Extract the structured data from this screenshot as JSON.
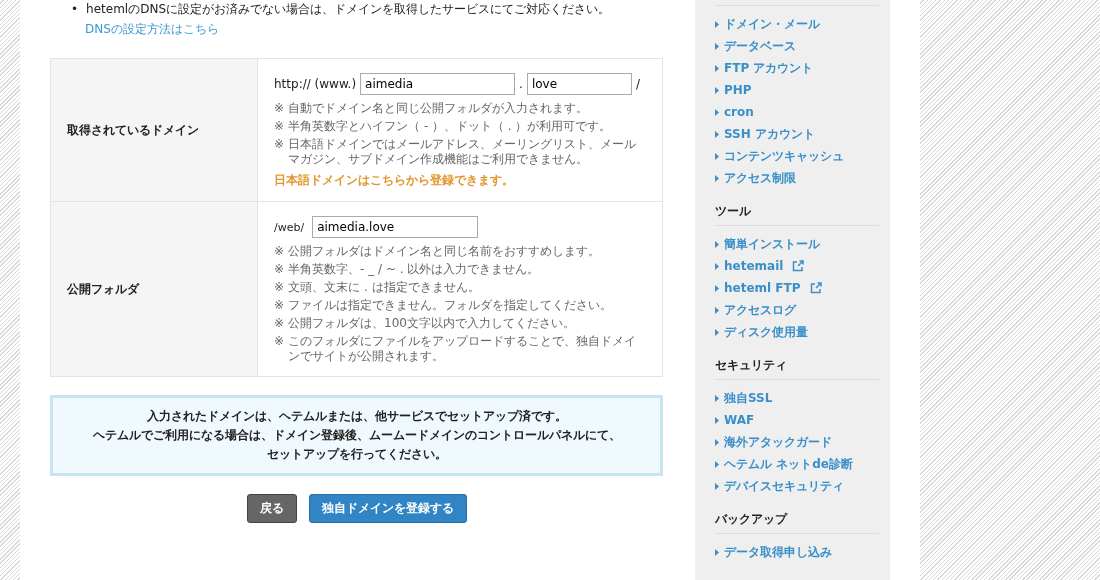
{
  "intro": {
    "bullet_mark": "•",
    "bullet": "hetemlのDNSに設定がお済みでない場合は、ドメインを取得したサービスにてご対応ください。",
    "link": "DNSの設定方法はこちら"
  },
  "form": {
    "rows": [
      {
        "kind": "domain",
        "label": "取得されているドメイン",
        "prefix": "http:// (www.)",
        "name_value": "aimedia",
        "dot": ".",
        "tld_value": "love",
        "suffix": "/",
        "notes": [
          "自動でドメイン名と同じ公開フォルダが入力されます。",
          "半角英数字とハイフン（ - ）、ドット（ . ）が利用可です。",
          "日本語ドメインではメールアドレス、メーリングリスト、メールマガジン、サブドメイン作成機能はご利用できません。"
        ],
        "note_mark": "※",
        "link": "日本語ドメインはこちらから登録できます。"
      },
      {
        "kind": "folder",
        "label": "公開フォルダ",
        "prefix": "/web/",
        "value": "aimedia.love",
        "notes": [
          "公開フォルダはドメイン名と同じ名前をおすすめします。",
          "半角英数字、- _ / ~ . 以外は入力できません。",
          "文頭、文末に . は指定できません。",
          "ファイルは指定できません。フォルダを指定してください。",
          "公開フォルダは、100文字以内で入力してください。",
          "このフォルダにファイルをアップロードすることで、独自ドメインでサイトが公開されます。"
        ],
        "note_mark": "※"
      }
    ]
  },
  "notice": [
    "入力されたドメインは、ヘテムルまたは、他サービスでセットアップ済です。",
    "ヘテムルでご利用になる場合は、ドメイン登録後、ムームードメインのコントロールパネルにて、",
    "セットアップを行ってください。"
  ],
  "buttons": [
    {
      "kind": "back",
      "label": "戻る"
    },
    {
      "kind": "primary",
      "label": "独自ドメインを登録する"
    }
  ],
  "sidebar": {
    "sections": [
      {
        "items": [
          {
            "label": "ドメイン・メール",
            "external": false
          },
          {
            "label": "データベース",
            "external": false
          },
          {
            "label": "FTP アカウント",
            "external": false
          },
          {
            "label": "PHP",
            "external": false
          },
          {
            "label": "cron",
            "external": false
          },
          {
            "label": "SSH アカウント",
            "external": false
          },
          {
            "label": "コンテンツキャッシュ",
            "external": false
          },
          {
            "label": "アクセス制限",
            "external": false
          }
        ]
      },
      {
        "title": "ツール",
        "items": [
          {
            "label": "簡単インストール",
            "external": false
          },
          {
            "label": "hetemail",
            "external": true
          },
          {
            "label": "heteml FTP",
            "external": true
          },
          {
            "label": "アクセスログ",
            "external": false
          },
          {
            "label": "ディスク使用量",
            "external": false
          }
        ]
      },
      {
        "title": "セキュリティ",
        "items": [
          {
            "label": "独自SSL",
            "external": false
          },
          {
            "label": "WAF",
            "external": false
          },
          {
            "label": "海外アタックガード",
            "external": false
          },
          {
            "label": "ヘテムル ネットde診断",
            "external": false
          },
          {
            "label": "デバイスセキュリティ",
            "external": false
          }
        ]
      },
      {
        "title": "バックアップ",
        "items": [
          {
            "label": "データ取得申し込み",
            "external": false
          }
        ]
      }
    ]
  }
}
